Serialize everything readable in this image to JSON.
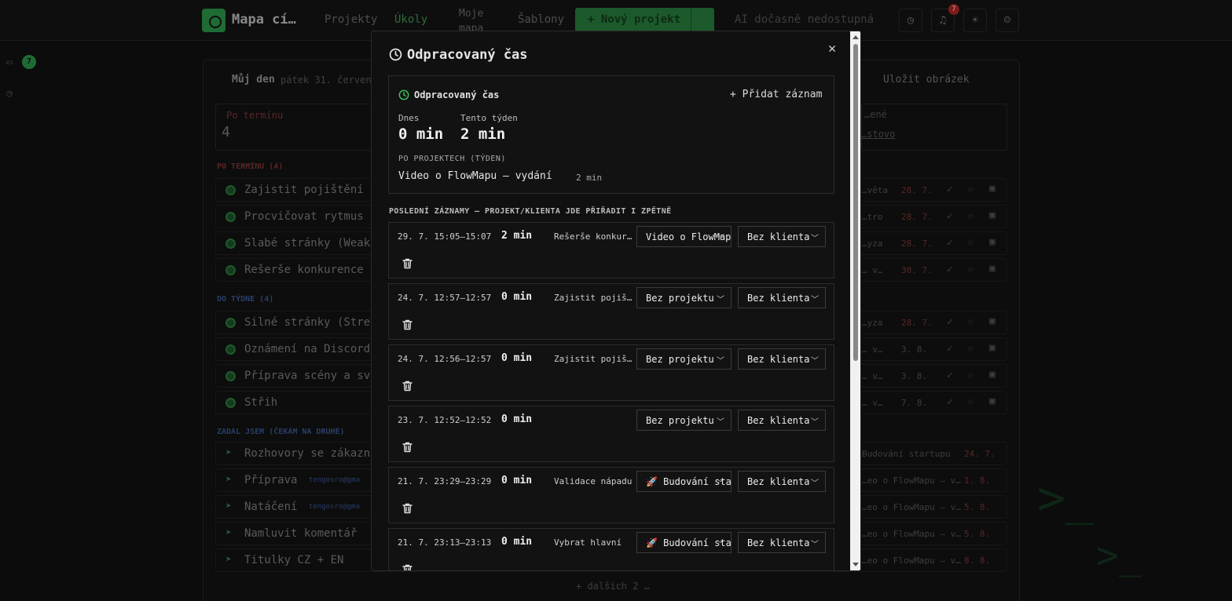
{
  "app": {
    "brand": "Mapa cí…",
    "nav": {
      "projects": "Projekty",
      "tasks": "Úkoly",
      "my_map": "Moje mapa",
      "templates": "Šablony"
    },
    "new_project": "+ Nový projekt",
    "ai_status": "AI dočasně nedostupná",
    "notification_count": "7",
    "sidebar_badge": "7",
    "panel_title": "Můj den",
    "panel_date": "pátek 31. července",
    "save_image": "Uložit obrázek",
    "overdue_label": "Po termínu",
    "overdue_count": "4",
    "done_label": "…ené",
    "done_link": "…stovo",
    "sections": [
      {
        "label": "PO TERMÍNU (4)",
        "color": "#5a2626"
      },
      {
        "label": "DO TÝDNE (4)",
        "color": "#2a3d6a"
      },
      {
        "label": "ZADAL JSEM (ČEKÁM NA DRUHÉ)",
        "color": "#2a3d6a"
      }
    ],
    "tasks": [
      {
        "title": "Zajistit pojištění a",
        "right": "…věta",
        "date": "28. 7.",
        "overdue": true
      },
      {
        "title": "Procvičovat rytmus a",
        "right": "…tro",
        "date": "28. 7.",
        "overdue": true
      },
      {
        "title": "Slabé stránky (Weakne",
        "right": "…yza",
        "date": "28. 7.",
        "overdue": true
      },
      {
        "title": "Rešerše konkurence",
        "right": "… v…",
        "date": "30. 7.",
        "overdue": true
      },
      {
        "title": "Silné stránky (Streng",
        "right": "…yza",
        "date": "28. 7.",
        "overdue": true
      },
      {
        "title": "Oznámení na Discordu",
        "right": "… v…",
        "date": "3. 8.",
        "overdue": false
      },
      {
        "title": "Příprava scény a svět",
        "right": "… v…",
        "date": "3. 8.",
        "overdue": false
      },
      {
        "title": "Střih",
        "right": "… v…",
        "date": "7. 8.",
        "overdue": false
      }
    ],
    "delegated": [
      {
        "title": "Rozhovory se zákazník",
        "right": "Budování startupu",
        "date": "24. 7."
      },
      {
        "title": "Příprava",
        "tag": "tengosro@gma",
        "right": "…eo o FlowMapu – v…",
        "date": "1. 8."
      },
      {
        "title": "Natáčení",
        "tag": "tengosro@gma",
        "right": "…eo o FlowMapu – v…",
        "date": "5. 8."
      },
      {
        "title": "Namluvit komentář",
        "right": "…eo o FlowMapu – v…",
        "date": "5. 8."
      },
      {
        "title": "Titulky CZ + EN",
        "right": "…eo o FlowMapu – v…",
        "date": "8. 8."
      }
    ],
    "more": "+ dalších 2 …"
  },
  "modal": {
    "title": "Odpracovaný čas",
    "summary": {
      "title": "Odpracovaný čas",
      "add_entry": "+ Přidat záznam",
      "today_label": "Dnes",
      "today_value": "0 min",
      "week_label": "Tento týden",
      "week_value": "2 min",
      "by_project_label": "PO PROJEKTECH (TÝDEN)",
      "project": {
        "name": "Video o FlowMapu – vydání",
        "time": "2 min"
      }
    },
    "recent_label": "POSLEDNÍ ZÁZNAMY – PROJEKT/KLIENTA JDE PŘIŘADIT I ZPĚTNĚ",
    "entries": [
      {
        "time": "29. 7.  15:05–15:07",
        "duration": "2 min",
        "task": "Rešerše konkurence",
        "project": "Video o FlowMapu",
        "client": "Bez klienta"
      },
      {
        "time": "24. 7.  12:57–12:57",
        "duration": "0 min",
        "task": "Zajistit pojištění",
        "project": "Bez projektu",
        "client": "Bez klienta"
      },
      {
        "time": "24. 7.  12:56–12:57",
        "duration": "0 min",
        "task": "Zajistit pojištění",
        "project": "Bez projektu",
        "client": "Bez klienta"
      },
      {
        "time": "23. 7.  12:52–12:52",
        "duration": "0 min",
        "task": "",
        "project": "Bez projektu",
        "client": "Bez klienta"
      },
      {
        "time": "21. 7.  23:29–23:29",
        "duration": "0 min",
        "task": "Validace nápadu",
        "project": "🚀 Budování startupu",
        "client": "Bez klienta"
      },
      {
        "time": "21. 7.  23:13–23:13",
        "duration": "0 min",
        "task": "Vybrat hlavní",
        "project": "🚀 Budování startupu",
        "client": "Bez klienta"
      }
    ]
  }
}
